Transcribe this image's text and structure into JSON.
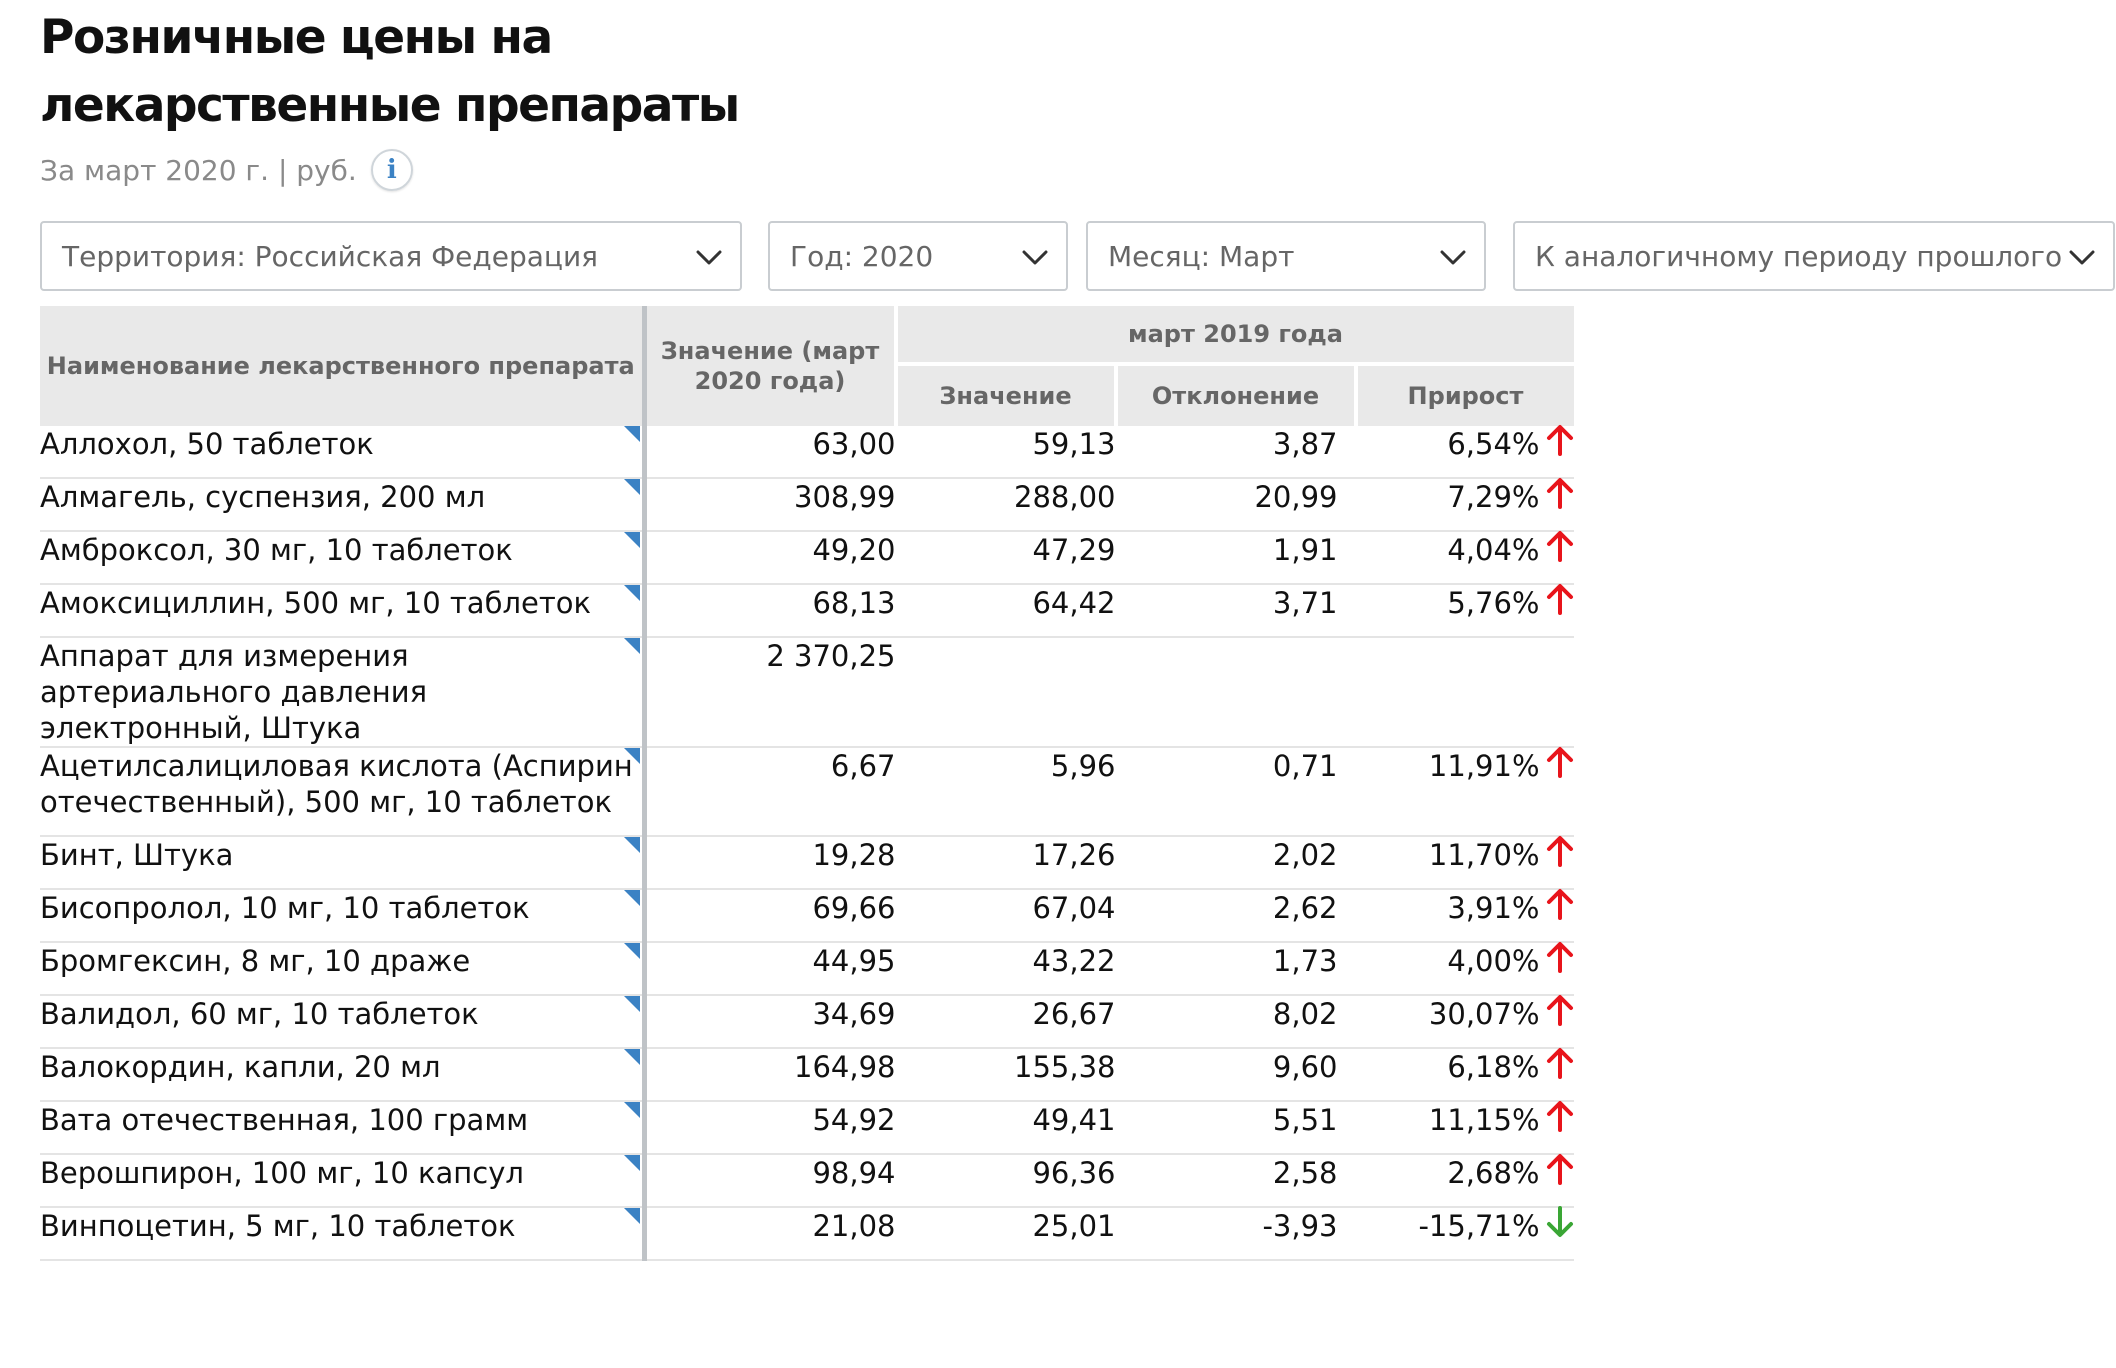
{
  "title": "Розничные цены на лекарственные препараты",
  "subtitle": "За март 2020 г. | руб.",
  "info_icon": "info-icon",
  "filters": [
    {
      "label": "Территория: Российская  Федерация"
    },
    {
      "label": "Год: 2020"
    },
    {
      "label": "Месяц: Март"
    },
    {
      "label": "К аналогичному периоду прошлого"
    }
  ],
  "table": {
    "col_name": "Наименование лекарственного препарата",
    "col_value": "Значение (март 2020 года)",
    "group": "март 2019 года",
    "sub_value": "Значение",
    "sub_deviation": "Отклонение",
    "sub_growth": "Прирост",
    "rows": [
      {
        "name": "Аллохол, 50 таблеток",
        "value": "63,00",
        "prev": "59,13",
        "dev": "3,87",
        "growth": "6,54%",
        "dir": "up"
      },
      {
        "name": "Алмагель, суспензия, 200 мл",
        "value": "308,99",
        "prev": "288,00",
        "dev": "20,99",
        "growth": "7,29%",
        "dir": "up"
      },
      {
        "name": "Амброксол, 30 мг, 10 таблеток",
        "value": "49,20",
        "prev": "47,29",
        "dev": "1,91",
        "growth": "4,04%",
        "dir": "up"
      },
      {
        "name": "Амоксициллин, 500 мг, 10 таблеток",
        "value": "68,13",
        "prev": "64,42",
        "dev": "3,71",
        "growth": "5,76%",
        "dir": "up"
      },
      {
        "name": "Аппарат для измерения артериального давления электронный, Штука",
        "value": "2 370,25",
        "prev": "",
        "dev": "",
        "growth": "",
        "dir": ""
      },
      {
        "name": "Ацетилсалициловая кислота (Аспирин отечественный), 500 мг, 10 таблеток",
        "value": "6,67",
        "prev": "5,96",
        "dev": "0,71",
        "growth": "11,91%",
        "dir": "up"
      },
      {
        "name": "Бинт, Штука",
        "value": "19,28",
        "prev": "17,26",
        "dev": "2,02",
        "growth": "11,70%",
        "dir": "up"
      },
      {
        "name": "Бисопролол, 10 мг, 10 таблеток",
        "value": "69,66",
        "prev": "67,04",
        "dev": "2,62",
        "growth": "3,91%",
        "dir": "up"
      },
      {
        "name": "Бромгексин, 8 мг, 10 драже",
        "value": "44,95",
        "prev": "43,22",
        "dev": "1,73",
        "growth": "4,00%",
        "dir": "up"
      },
      {
        "name": "Валидол, 60 мг, 10 таблеток",
        "value": "34,69",
        "prev": "26,67",
        "dev": "8,02",
        "growth": "30,07%",
        "dir": "up"
      },
      {
        "name": "Валокордин, капли, 20 мл",
        "value": "164,98",
        "prev": "155,38",
        "dev": "9,60",
        "growth": "6,18%",
        "dir": "up"
      },
      {
        "name": "Вата отечественная, 100 грамм",
        "value": "54,92",
        "prev": "49,41",
        "dev": "5,51",
        "growth": "11,15%",
        "dir": "up"
      },
      {
        "name": "Верошпирон, 100 мг, 10 капсул",
        "value": "98,94",
        "prev": "96,36",
        "dev": "2,58",
        "growth": "2,68%",
        "dir": "up"
      },
      {
        "name": "Винпоцетин, 5 мг, 10 таблеток",
        "value": "21,08",
        "prev": "25,01",
        "dev": "-3,93",
        "growth": "-15,71%",
        "dir": "down"
      }
    ]
  },
  "colors": {
    "up": "#e8141b",
    "down": "#3aa635",
    "accent": "#3b82c4"
  }
}
